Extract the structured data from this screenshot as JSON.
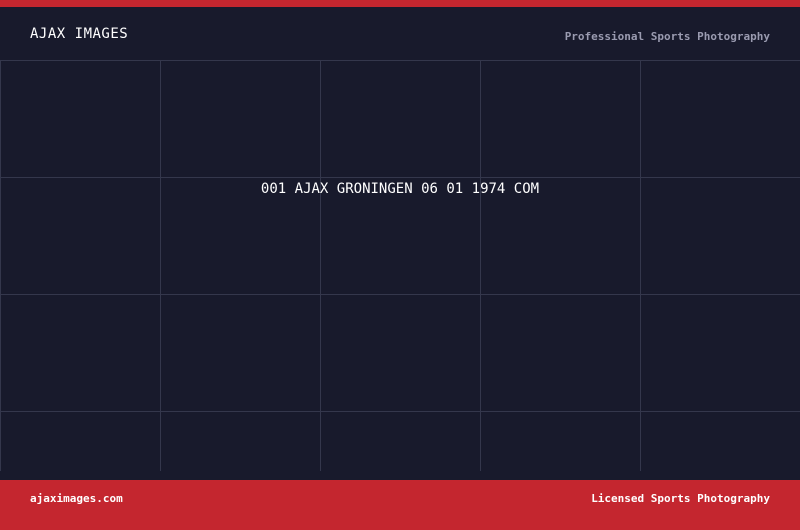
{
  "colors": {
    "accent": "#c4262f",
    "background": "#181a2c",
    "grid": "#34374c",
    "muted_text": "#9a9bb0"
  },
  "header": {
    "brand": "AJAX IMAGES",
    "tagline": "Professional Sports Photography"
  },
  "main": {
    "image_title": "001 AJAX GRONINGEN 06 01 1974 COM"
  },
  "footer": {
    "domain": "ajaximages.com",
    "license": "Licensed Sports Photography"
  }
}
